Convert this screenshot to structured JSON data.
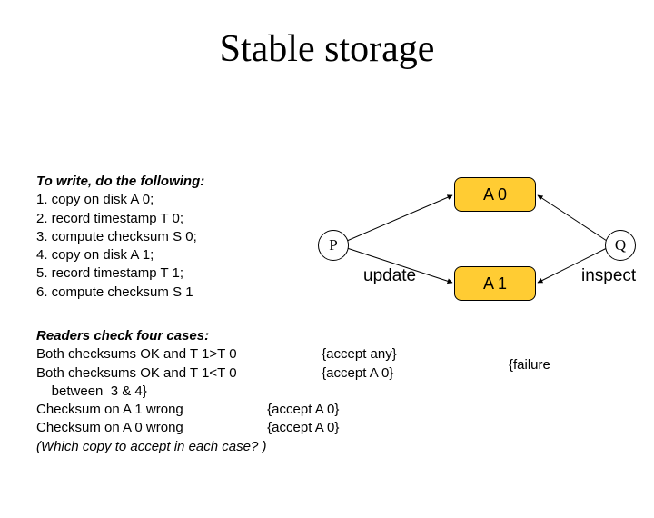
{
  "title": "Stable storage",
  "write": {
    "header": "To write, do the following:",
    "s1": "1. copy on disk A 0;",
    "s2": "2.  record timestamp T 0;",
    "s3": "3.          compute checksum S 0;",
    "s4": "4. copy on disk A 1;",
    "s5": "5.  record timestamp T 1;",
    "s6": "6.          compute checksum S 1"
  },
  "diagram": {
    "p": "P",
    "q": "Q",
    "a0": "A 0",
    "a1": "A 1",
    "update": "update",
    "inspect": "inspect"
  },
  "readers": {
    "header": "Readers check four cases:",
    "r1a": "Both checksums OK and T 1>T 0",
    "r1b": "{accept any}",
    "r2a": "Both checksums OK and T 1<T 0",
    "r2b": "{accept A 0}",
    "r2c": "    between  3 & 4}",
    "r3a": "Checksum on A 1 wrong",
    "r3b": "{accept A 0}",
    "r4a": "Checksum on A 0 wrong",
    "r4b": "{accept A 0}",
    "r5": " (Which copy to accept in each case? )",
    "failure": "{failure"
  }
}
